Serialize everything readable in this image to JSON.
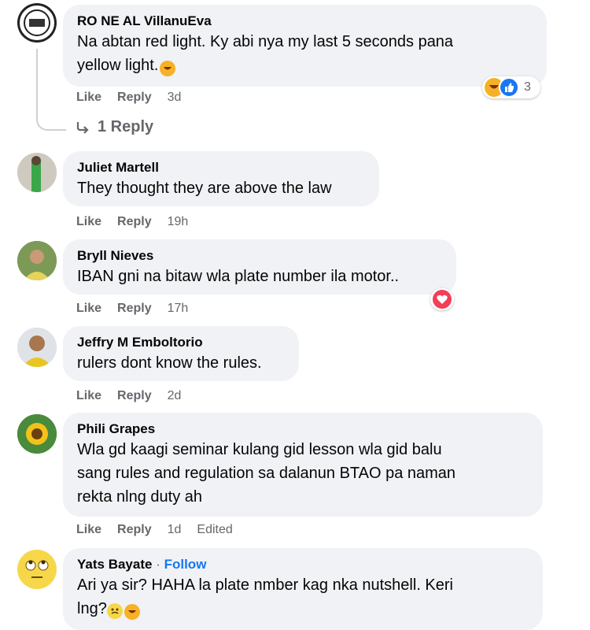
{
  "actions": {
    "like": "Like",
    "reply": "Reply"
  },
  "replies_link": "1 Reply",
  "comments": [
    {
      "author": "RO NE AL VillanuEva",
      "text1": "Na abtan red light. Ky abi nya my last 5 seconds pana",
      "text2": "yellow light.",
      "time": "3d",
      "reaction_count": "3"
    },
    {
      "author": "Juliet Martell",
      "text1": "They thought they are above the law",
      "time": "19h"
    },
    {
      "author": "Bryll Nieves",
      "text1": "IBAN gni na bitaw wla plate number ila motor..",
      "time": "17h"
    },
    {
      "author": "Jeffry M Emboltorio",
      "text1": "rulers dont know the rules.",
      "time": "2d"
    },
    {
      "author": "Phili Grapes",
      "text1": "Wla gd kaagi seminar kulang gid lesson wla gid balu",
      "text2": "sang rules and regulation sa dalanun BTAO pa naman",
      "text3": "rekta nlng duty ah",
      "time": "1d",
      "edited": "Edited"
    },
    {
      "author": "Yats Bayate",
      "separator": "·",
      "follow": "Follow",
      "text1": "Ari ya sir? HAHA la plate nmber kag nka nutshell. Keri",
      "text2": "lng?"
    }
  ],
  "icons": {
    "haha": "haha-emoji-icon",
    "like": "like-reaction-icon",
    "love": "love-reaction-icon",
    "reply_arrow": "reply-arrow-icon"
  },
  "colors": {
    "bubble": "#f0f2f5",
    "secondary_text": "#65676b",
    "link": "#1877f2",
    "love": "#f33e58",
    "like": "#1877f2",
    "haha": "#f7b125"
  }
}
